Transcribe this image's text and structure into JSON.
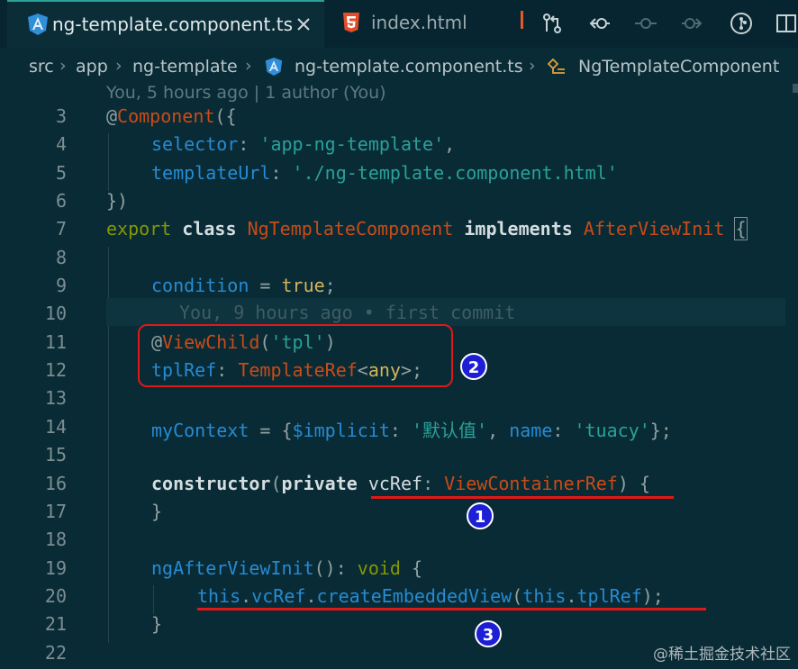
{
  "tabs": [
    {
      "label": "ng-template.component.ts",
      "icon": "angular-icon",
      "active": true
    },
    {
      "label": "index.html",
      "icon": "html5-icon",
      "active": false
    }
  ],
  "toolbar_icons": [
    "git-compare-icon",
    "previous-change-icon",
    "commit-icon",
    "next-change-icon",
    "git-graph-icon",
    "split-editor-icon"
  ],
  "breadcrumb": {
    "items": [
      "src",
      "app",
      "ng-template",
      "ng-template.component.ts",
      "NgTemplateComponent"
    ]
  },
  "blame": {
    "header": "You, 5 hours ago | 1 author (You)",
    "inline": "You, 9 hours ago • first commit"
  },
  "line_numbers": [
    "3",
    "4",
    "5",
    "6",
    "7",
    "8",
    "9",
    "10",
    "11",
    "12",
    "13",
    "14",
    "15",
    "16",
    "17",
    "18",
    "19",
    "20",
    "21",
    "22"
  ],
  "code": {
    "l3": {
      "at": "@",
      "name": "Component",
      "rest": "({"
    },
    "l4": {
      "key": "selector",
      "colon": ": ",
      "value": "'app-ng-template'",
      "end": ","
    },
    "l5": {
      "key": "templateUrl",
      "colon": ": ",
      "value": "'./ng-template.component.html'"
    },
    "l6": {
      "text": "})"
    },
    "l7": {
      "export": "export",
      "class": "class",
      "name": "NgTemplateComponent",
      "implements": "implements",
      "iface": "AfterViewInit",
      "brace": "{"
    },
    "l9": {
      "prop": "condition",
      "eq": " = ",
      "val": "true",
      "end": ";"
    },
    "l11": {
      "at": "@",
      "name": "ViewChild",
      "open": "(",
      "arg": "'tpl'",
      "close": ")"
    },
    "l12": {
      "prop": "tplRef",
      "colon": ": ",
      "type": "TemplateRef",
      "lt": "<",
      "generic": "any",
      "gt": ">;"
    },
    "l14": {
      "prop": "myContext",
      "eq": " = {",
      "k1": "$implicit",
      "c1": ": ",
      "v1": "'默认值'",
      "sep": ", ",
      "k2": "name",
      "c2": ": ",
      "v2": "'tuacy'",
      "end": "};"
    },
    "l16": {
      "kw": "constructor",
      "open": "(",
      "mod": "private",
      "sp": " ",
      "param": "vcRef",
      "colon": ": ",
      "type": "ViewContainerRef",
      "close": ") {"
    },
    "l17": {
      "text": "}"
    },
    "l19": {
      "fn": "ngAfterViewInit",
      "paren": "(): ",
      "ret": "void",
      "brace": " {"
    },
    "l20": {
      "this1": "this",
      "dot1": ".",
      "p1": "vcRef",
      "dot2": ".",
      "fn": "createEmbeddedView",
      "open": "(",
      "this2": "this",
      "dot3": ".",
      "p2": "tplRef",
      "close": ");"
    },
    "l21": {
      "text": "}"
    }
  },
  "annotations": {
    "badge1": "1",
    "badge2": "2",
    "badge3": "3"
  },
  "watermark": "@稀土掘金技术社区"
}
